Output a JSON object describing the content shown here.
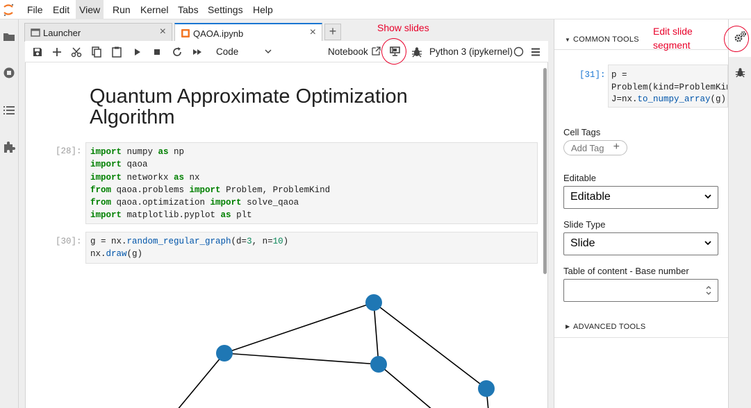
{
  "menu": [
    "File",
    "Edit",
    "View",
    "Run",
    "Kernel",
    "Tabs",
    "Settings",
    "Help"
  ],
  "active_menu": "View",
  "tabs": [
    {
      "label": "Launcher",
      "close": "×"
    },
    {
      "label": "QAOA.ipynb",
      "close": "×"
    }
  ],
  "new_tab": "+",
  "toolbar": {
    "cell_type": "Code",
    "notebook_label": "Notebook",
    "kernel_name": "Python 3 (ipykernel)"
  },
  "notebook": {
    "title": "Quantum Approximate Optimization Algorithm",
    "cells": [
      {
        "prompt": "[28]:"
      },
      {
        "prompt": "[30]:"
      }
    ]
  },
  "right_panel": {
    "common_tools": "COMMON TOOLS",
    "preview_prompt": "[31]:",
    "cell_tags_label": "Cell Tags",
    "add_tag": "Add Tag",
    "add_tag_plus": "+",
    "editable_label": "Editable",
    "editable_value": "Editable",
    "slide_type_label": "Slide Type",
    "slide_type_value": "Slide",
    "toc_label": "Table of content - Base number",
    "toc_value": "",
    "advanced_tools": "ADVANCED TOOLS"
  },
  "annotations": {
    "show_slides": "Show slides",
    "edit_slide_1": "Edit slide",
    "edit_slide_2": "segment"
  },
  "colors": {
    "accent": "#1976d2",
    "node": "#1f77b4",
    "annotation": "#e8002a",
    "keyword": "#008000"
  },
  "icons": [
    "jupyter-logo-icon",
    "folder-icon",
    "running-icon",
    "toc-icon",
    "extension-icon",
    "save-icon",
    "insert-cell-icon",
    "cut-icon",
    "copy-icon",
    "paste-icon",
    "run-icon",
    "stop-icon",
    "restart-icon",
    "fast-forward-icon",
    "chevron-down-icon",
    "external-link-icon",
    "slides-icon",
    "bug-icon",
    "kernel-status-icon",
    "menu-icon",
    "gear-icon",
    "debug-icon"
  ]
}
